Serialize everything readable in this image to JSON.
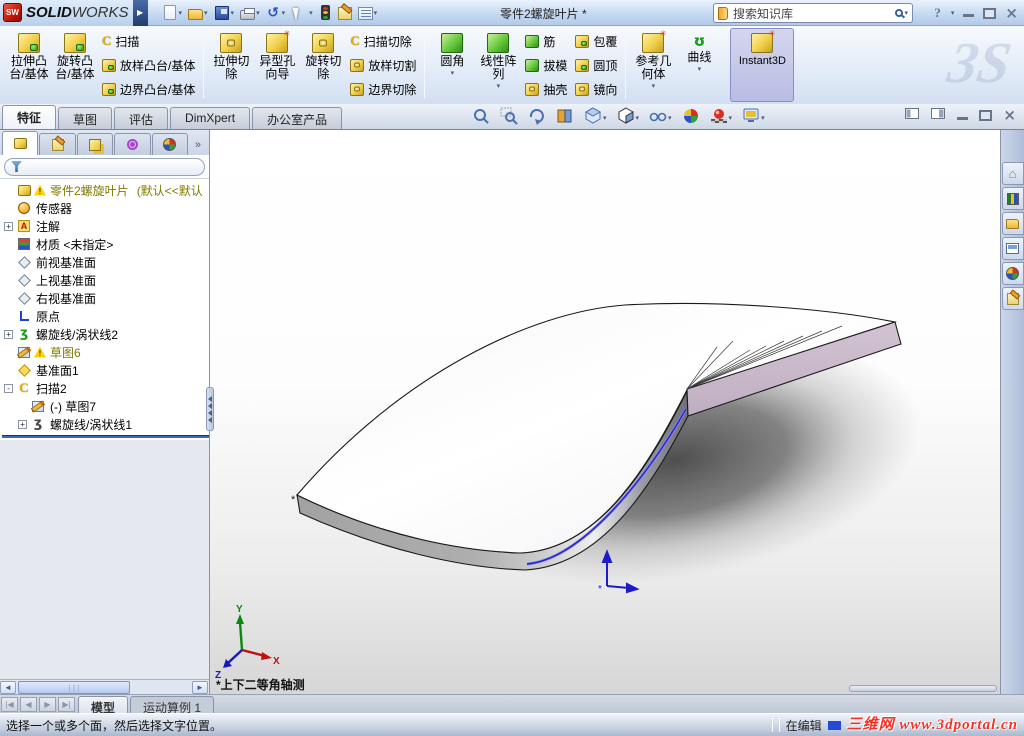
{
  "titlebar": {
    "brand_bold": "SOLID",
    "brand_rest": "WORKS",
    "title": "零件2螺旋叶片 *",
    "search_placeholder": "搜索知识库",
    "tool_buttons": [
      "new",
      "open",
      "save",
      "print",
      "undo",
      "select",
      "rebuild-traffic-light",
      "options",
      "design-checker"
    ],
    "window_buttons": [
      "help",
      "minimize",
      "restore",
      "close"
    ]
  },
  "ribbon": {
    "items": [
      {
        "k": "big",
        "label": "拉伸凸台/基体",
        "icon": "boss-extrude"
      },
      {
        "k": "big",
        "label": "旋转凸台/基体",
        "icon": "boss-revolve"
      },
      {
        "k": "stack",
        "items": [
          {
            "label": "扫描",
            "icon": "sweep"
          },
          {
            "label": "放样凸台/基体",
            "icon": "loft"
          },
          {
            "label": "边界凸台/基体",
            "icon": "boundary"
          }
        ]
      },
      {
        "k": "sep"
      },
      {
        "k": "big",
        "label": "拉伸切除",
        "icon": "cut-extrude"
      },
      {
        "k": "big",
        "label": "异型孔向导",
        "icon": "hole-wizard"
      },
      {
        "k": "big",
        "label": "旋转切除",
        "icon": "cut-revolve"
      },
      {
        "k": "stack",
        "items": [
          {
            "label": "扫描切除",
            "icon": "cut-sweep"
          },
          {
            "label": "放样切割",
            "icon": "cut-loft"
          },
          {
            "label": "边界切除",
            "icon": "cut-boundary"
          }
        ]
      },
      {
        "k": "sep"
      },
      {
        "k": "big",
        "label": "圆角",
        "icon": "fillet",
        "arrow": true
      },
      {
        "k": "big",
        "label": "线性阵列",
        "icon": "linear-pattern",
        "arrow": true
      },
      {
        "k": "stack",
        "items": [
          {
            "label": "筋",
            "icon": "rib"
          },
          {
            "label": "拔模",
            "icon": "draft"
          },
          {
            "label": "抽壳",
            "icon": "shell"
          }
        ]
      },
      {
        "k": "stack",
        "items": [
          {
            "label": "包覆",
            "icon": "wrap"
          },
          {
            "label": "圆顶",
            "icon": "dome"
          },
          {
            "label": "镜向",
            "icon": "mirror"
          }
        ]
      },
      {
        "k": "sep"
      },
      {
        "k": "big",
        "label": "参考几何体",
        "icon": "reference-geometry",
        "arrow": true
      },
      {
        "k": "big",
        "label": "曲线",
        "icon": "curves",
        "arrow": true
      },
      {
        "k": "big3d",
        "label": "Instant3D",
        "icon": "instant3d"
      }
    ]
  },
  "command_tabs": [
    {
      "label": "特征",
      "active": true
    },
    {
      "label": "草图",
      "active": false
    },
    {
      "label": "评估",
      "active": false
    },
    {
      "label": "DimXpert",
      "active": false
    },
    {
      "label": "办公室产品",
      "active": false
    }
  ],
  "headsup": [
    {
      "name": "zoom-fit",
      "arrow": false
    },
    {
      "name": "zoom-area",
      "arrow": false
    },
    {
      "name": "rotate-view",
      "arrow": false
    },
    {
      "name": "section-view",
      "arrow": false
    },
    {
      "name": "view-orientation",
      "arrow": true
    },
    {
      "name": "display-style",
      "arrow": true
    },
    {
      "name": "hide-show-items",
      "arrow": true
    },
    {
      "name": "edit-appearance",
      "arrow": false
    },
    {
      "name": "apply-scene",
      "arrow": true
    },
    {
      "name": "view-settings",
      "arrow": true
    }
  ],
  "doc_window_buttons": [
    "pane-left",
    "pane-right",
    "minimize",
    "restore",
    "close"
  ],
  "panel": {
    "tabs": [
      "featuremanager",
      "propertymanager",
      "configurationmanager",
      "dimxpertmanager",
      "displaymanager"
    ],
    "overflow": "»",
    "tree": [
      {
        "label": "零件2螺旋叶片",
        "suffix": "(默认<<默认",
        "icon": "part",
        "warn": true,
        "olive": true
      },
      {
        "label": "传感器",
        "icon": "sensor"
      },
      {
        "label": "注解",
        "icon": "annotations",
        "expand": "+"
      },
      {
        "label": "材质 <未指定>",
        "icon": "material"
      },
      {
        "label": "前视基准面",
        "icon": "plane"
      },
      {
        "label": "上视基准面",
        "icon": "plane"
      },
      {
        "label": "右视基准面",
        "icon": "plane"
      },
      {
        "label": "原点",
        "icon": "origin"
      },
      {
        "label": "螺旋线/涡状线2",
        "icon": "helix-green",
        "expand": "+"
      },
      {
        "label": "草图6",
        "icon": "sketch",
        "warn": true,
        "olive": true
      },
      {
        "label": "基准面1",
        "icon": "plane-yellow"
      },
      {
        "label": "扫描2",
        "icon": "sweep",
        "expand": "-"
      },
      {
        "label": "(-) 草图7",
        "icon": "sketch",
        "indent": 1
      },
      {
        "label": "螺旋线/涡状线1",
        "icon": "helix-dark",
        "expand": "+",
        "indent": 1
      }
    ]
  },
  "viewport": {
    "view_label": "*上下二等角轴测",
    "triad_labels": {
      "x": "X",
      "y": "Y",
      "z": "Z"
    }
  },
  "taskpane_buttons": [
    "resources-home",
    "design-library",
    "file-explorer",
    "view-palette",
    "appearances",
    "custom-properties"
  ],
  "bottom": {
    "nav": [
      "|◀",
      "◀",
      "▶",
      "▶|"
    ],
    "tabs": [
      {
        "label": "模型",
        "active": true
      },
      {
        "label": "运动算例 1",
        "active": false
      }
    ]
  },
  "statusbar": {
    "message": "选择一个或多个面，然后选择文字位置。",
    "mode": "在编辑",
    "watermark": "三维网 www.3dportal.cn"
  }
}
